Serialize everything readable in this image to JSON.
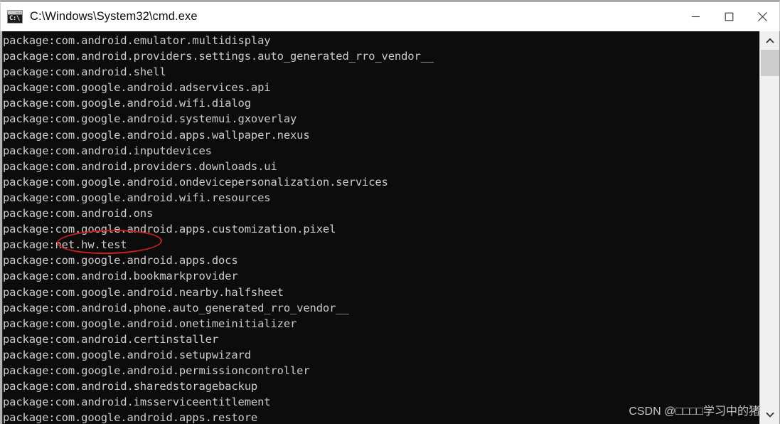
{
  "window": {
    "title": "C:\\Windows\\System32\\cmd.exe",
    "icon_name": "cmd-console-icon",
    "icon_text": "C:\\",
    "background_color": "#0c0c0c",
    "text_color": "#cccccc",
    "titlebar_color": "#ffffff"
  },
  "titlebar_controls": {
    "minimize_label": "Minimize",
    "maximize_label": "Maximize",
    "close_label": "Close"
  },
  "console": {
    "lines": [
      "package:com.android.emulator.multidisplay",
      "package:com.android.providers.settings.auto_generated_rro_vendor__",
      "package:com.android.shell",
      "package:com.google.android.adservices.api",
      "package:com.google.android.wifi.dialog",
      "package:com.google.android.systemui.gxoverlay",
      "package:com.google.android.apps.wallpaper.nexus",
      "package:com.android.inputdevices",
      "package:com.android.providers.downloads.ui",
      "package:com.google.android.ondevicepersonalization.services",
      "package:com.google.android.wifi.resources",
      "package:com.android.ons",
      "package:com.google.android.apps.customization.pixel",
      "package:net.hw.test",
      "package:com.google.android.apps.docs",
      "package:com.android.bookmarkprovider",
      "package:com.google.android.nearby.halfsheet",
      "package:com.android.phone.auto_generated_rro_vendor__",
      "package:com.google.android.onetimeinitializer",
      "package:com.android.certinstaller",
      "package:com.google.android.setupwizard",
      "package:com.google.android.permissioncontroller",
      "package:com.android.sharedstoragebackup",
      "package:com.android.imsserviceentitlement",
      "package:com.google.android.apps.restore"
    ]
  },
  "annotation": {
    "shape": "ellipse",
    "color": "#cc1f1f",
    "highlighted_text": ":net.hw.test",
    "target_line": "package:net.hw.test"
  },
  "watermark": {
    "text": "CSDN @□□□□学习中的猪"
  },
  "scrollbar": {
    "up_arrow_name": "scroll-up-arrow",
    "down_arrow_name": "scroll-down-arrow",
    "thumb_name": "scrollbar-thumb",
    "track_color": "#f0f0f0",
    "thumb_color": "#cdcdcd"
  }
}
